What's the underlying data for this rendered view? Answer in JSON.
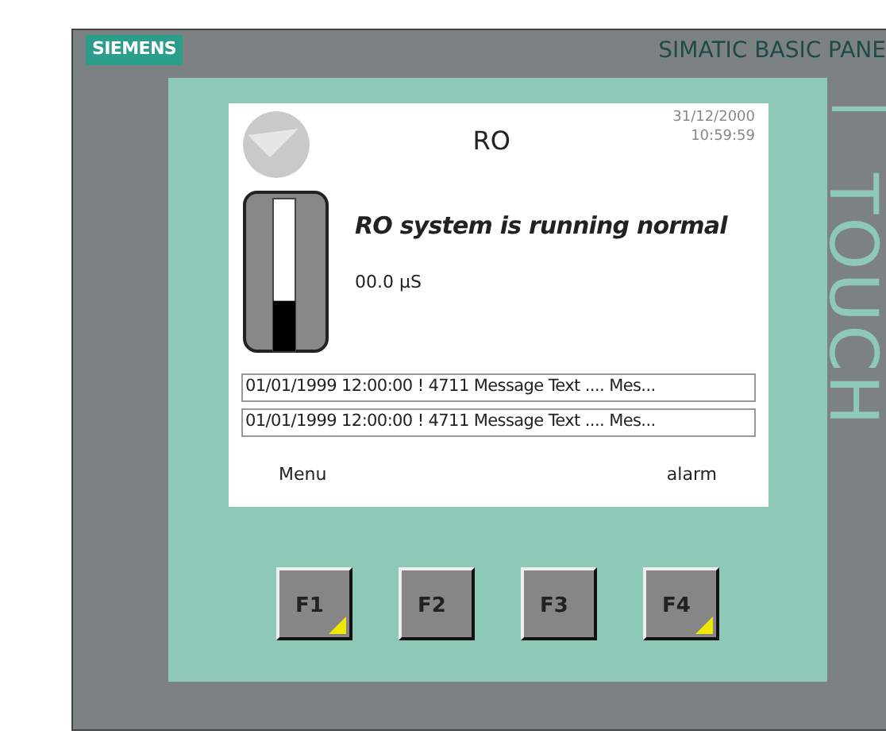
{
  "device": {
    "brand": "SIEMENS",
    "model": "SIMATIC BASIC PANE",
    "side_label": "TOUCH"
  },
  "screen": {
    "title": "RO",
    "date": "31/12/2000",
    "time": "10:59:59",
    "status": "RO system is running normal",
    "reading": "00.0  µS",
    "tank": {
      "level": 0.33
    },
    "alarms": [
      "01/01/1999 12:00:00 ! 4711 Message Text .... Mes...",
      "01/01/1999 12:00:00 ! 4711 Message Text .... Mes..."
    ],
    "soft_labels": [
      "Menu",
      "alarm"
    ]
  },
  "keys": [
    {
      "label": "F1",
      "marked": true
    },
    {
      "label": "F2",
      "marked": false
    },
    {
      "label": "F3",
      "marked": false
    },
    {
      "label": "F4",
      "marked": true
    }
  ]
}
